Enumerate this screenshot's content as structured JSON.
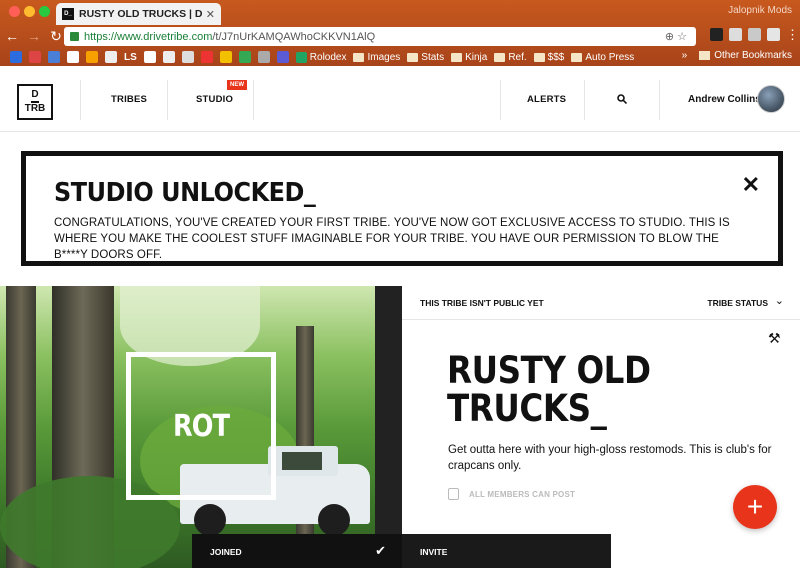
{
  "browser": {
    "tab_title": "RUSTY OLD TRUCKS | DRIVE",
    "tab_favicon": "D_",
    "profile": "Jalopnik Mods",
    "url_host": "https://www.drivetribe.com",
    "url_path": "/t/J7nUrKAMQAWhoCKKVN1AlQ",
    "bookmarks": [
      "LS",
      "Rolodex",
      "Images",
      "Stats",
      "Kinja",
      "Ref.",
      "$$$",
      "Auto Press"
    ],
    "other_bookmarks": "Other Bookmarks",
    "overflow": "»"
  },
  "site": {
    "logo_top": "D",
    "logo_bottom": "TRB",
    "nav_tribes": "TRIBES",
    "nav_studio": "STUDIO",
    "studio_badge": "NEW",
    "nav_alerts": "ALERTS",
    "user_name": "Andrew Collins"
  },
  "banner": {
    "title": "STUDIO UNLOCKED_",
    "text": "CONGRATULATIONS, YOU'VE CREATED YOUR FIRST TRIBE. YOU'VE NOW GOT EXCLUSIVE ACCESS TO STUDIO. THIS IS WHERE YOU MAKE THE COOLEST STUFF IMAGINABLE FOR YOUR TRIBE. YOU HAVE OUR PERMISSION TO BLOW THE B****Y DOORS OFF.",
    "close": "✕"
  },
  "tribe": {
    "hero_label": "ROT",
    "status_text": "THIS TRIBE ISN'T PUBLIC YET",
    "status_menu": "TRIBE STATUS",
    "title": "RUSTY OLD TRUCKS_",
    "description": "Get outta here with your high-gloss restomods. This is club's for crapcans only.",
    "members_setting": "ALL MEMBERS CAN POST",
    "fab": "+"
  },
  "bottom_bar": {
    "joined": "JOINED",
    "invite": "INVITE"
  },
  "colors": {
    "accent": "#e8341a",
    "chrome": "#b84d1c"
  }
}
